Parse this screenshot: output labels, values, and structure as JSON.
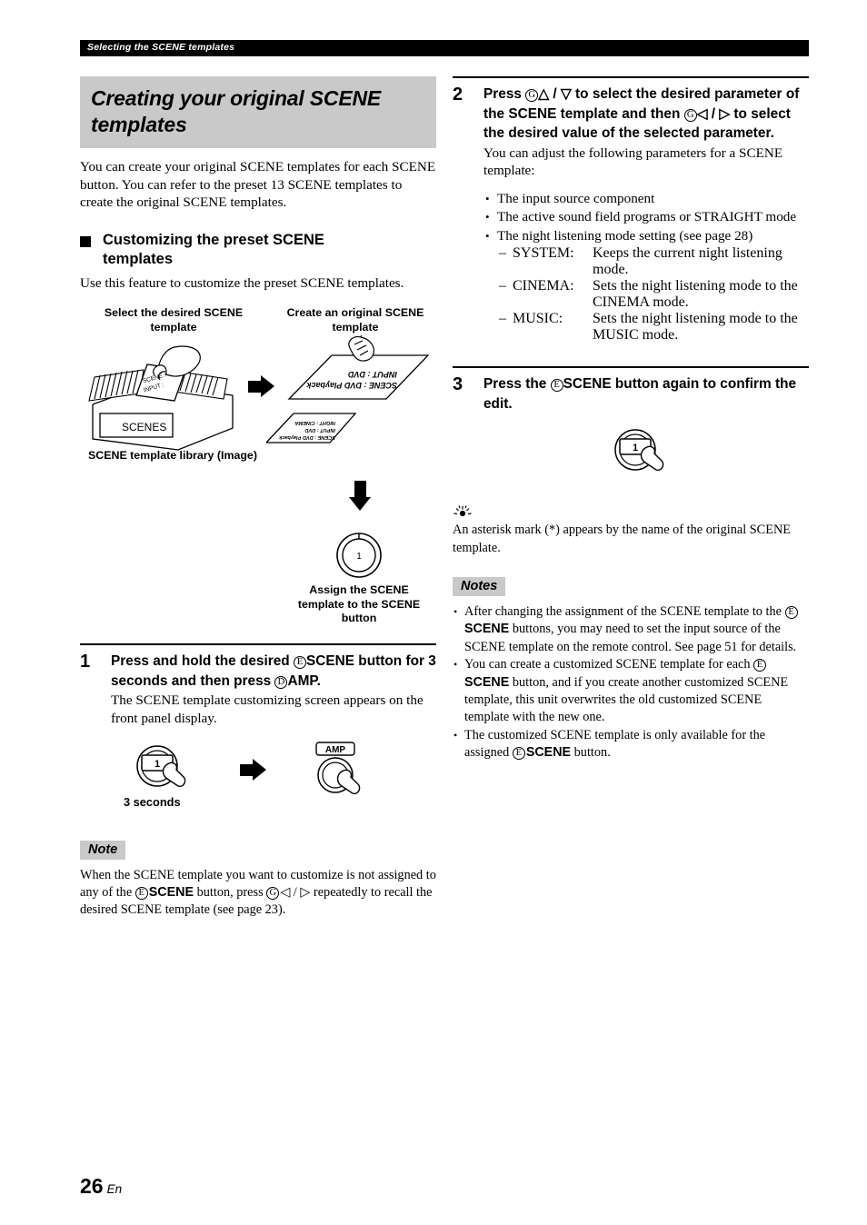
{
  "running_head": "Selecting the SCENE templates",
  "section": {
    "title": "Creating your original SCENE templates",
    "intro": "You can create your original SCENE templates for each SCENE button. You can refer to the preset 13 SCENE templates to create the original SCENE templates.",
    "subhead": "Customizing the preset SCENE templates",
    "subhead_body": "Use this feature to customize the preset SCENE templates."
  },
  "figure": {
    "caption_select": "Select the desired SCENE template",
    "caption_create": "Create an original SCENE template",
    "caption_library": "SCENE template library (Image)",
    "caption_assign": "Assign the SCENE template to the SCENE button",
    "box_label": "SCENES",
    "card_line1": "SCENE :",
    "card_line2": "INPUT :",
    "sheet_top_line1": "SCENE : DVD Playback",
    "sheet_top_line2": "INPUT : DVD",
    "sheet_back_line1": "SCENE : DVD Playback",
    "sheet_back_line2": "INPUT : DVD",
    "sheet_back_line3": "NIGHT : CINEMA",
    "button_number": "1"
  },
  "steps": [
    {
      "number": "1",
      "head_parts": [
        {
          "t": "text",
          "v": "Press and hold the desired "
        },
        {
          "t": "key",
          "v": "E"
        },
        {
          "t": "bold",
          "v": "SCENE"
        },
        {
          "t": "text",
          "v": " button for 3 seconds and then press "
        },
        {
          "t": "key",
          "v": "D"
        },
        {
          "t": "bold",
          "v": "AMP."
        }
      ],
      "body": "The SCENE template customizing screen appears on the front panel display.",
      "art_labels": {
        "hold_duration": "3 seconds",
        "button_number": "1",
        "amp_label": "AMP"
      }
    },
    {
      "number": "2",
      "head_parts": [
        {
          "t": "text",
          "v": "Press "
        },
        {
          "t": "key",
          "v": "G"
        },
        {
          "t": "glyph",
          "v": "up"
        },
        {
          "t": "text",
          "v": " / "
        },
        {
          "t": "glyph",
          "v": "down"
        },
        {
          "t": "text",
          "v": " to select the desired parameter of the SCENE template and then "
        },
        {
          "t": "key",
          "v": "G"
        },
        {
          "t": "glyph",
          "v": "left"
        },
        {
          "t": "text",
          "v": " / "
        },
        {
          "t": "glyph",
          "v": "right"
        },
        {
          "t": "text",
          "v": " to select the desired value of the selected parameter."
        }
      ],
      "body": "You can adjust the following parameters for a SCENE template:",
      "bullets": [
        "The input source component",
        "The active sound field programs or STRAIGHT mode",
        "The night listening mode setting (see page 28)"
      ],
      "sub_items": [
        {
          "term": "SYSTEM:",
          "def": "Keeps the current night listening mode."
        },
        {
          "term": "CINEMA:",
          "def": "Sets the night listening mode to the CINEMA mode."
        },
        {
          "term": "MUSIC:",
          "def": "Sets the night listening mode to the MUSIC mode."
        }
      ]
    },
    {
      "number": "3",
      "head_parts": [
        {
          "t": "text",
          "v": "Press the "
        },
        {
          "t": "key",
          "v": "E"
        },
        {
          "t": "bold",
          "v": "SCENE"
        },
        {
          "t": "text",
          "v": " button again to confirm the edit."
        }
      ],
      "art_labels": {
        "button_number": "1"
      }
    }
  ],
  "tip": {
    "icon": "tip-bulb-icon",
    "body": "An asterisk mark (*) appears by the name of the original SCENE template."
  },
  "note": {
    "label": "Note",
    "parts": [
      {
        "t": "text",
        "v": "When the SCENE template you want to customize is not assigned to any of the "
      },
      {
        "t": "key",
        "v": "E"
      },
      {
        "t": "bold",
        "v": "SCENE"
      },
      {
        "t": "text",
        "v": " button, press "
      },
      {
        "t": "key",
        "v": "G"
      },
      {
        "t": "glyph",
        "v": "left"
      },
      {
        "t": "text",
        "v": " / "
      },
      {
        "t": "glyph",
        "v": "right"
      },
      {
        "t": "text",
        "v": " repeatedly to recall the desired SCENE template (see page 23)."
      }
    ]
  },
  "notes": {
    "label": "Notes",
    "items": [
      [
        {
          "t": "text",
          "v": "After changing the assignment of the SCENE template to the "
        },
        {
          "t": "key",
          "v": "E"
        },
        {
          "t": "bold",
          "v": "SCENE"
        },
        {
          "t": "text",
          "v": " buttons, you may need to set the input source of the SCENE template on the remote control. See page 51 for details."
        }
      ],
      [
        {
          "t": "text",
          "v": "You can create a customized SCENE template for each "
        },
        {
          "t": "key",
          "v": "E"
        },
        {
          "t": "bold",
          "v": "SCENE"
        },
        {
          "t": "text",
          "v": " button, and if you create another customized SCENE template, this unit overwrites the old customized SCENE template with the new one."
        }
      ],
      [
        {
          "t": "text",
          "v": "The customized SCENE template is only available for the assigned "
        },
        {
          "t": "key",
          "v": "E"
        },
        {
          "t": "bold",
          "v": "SCENE"
        },
        {
          "t": "text",
          "v": " button."
        }
      ]
    ]
  },
  "folio": {
    "page_number": "26",
    "language": "En"
  },
  "colors": {
    "banner_gray": "#c9c9c9",
    "runhead_black": "#000000"
  }
}
